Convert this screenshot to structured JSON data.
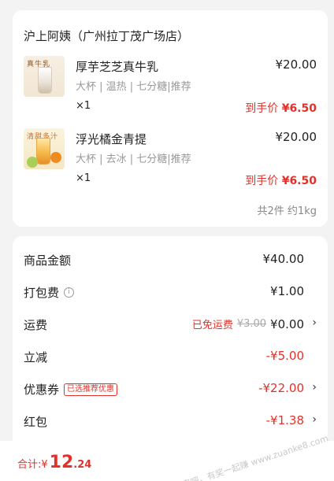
{
  "store": {
    "name": "沪上阿姨（广州拉丁茂广场店）"
  },
  "products": [
    {
      "thumb_label": "真牛乳",
      "name": "厚芋芝芝真牛乳",
      "spec": "大杯 | 温热 | 七分糖|推荐",
      "qty": "×1",
      "price": "¥20.00",
      "final_prefix": "到手价",
      "final_amount": "¥6.50"
    },
    {
      "thumb_label": "清甜多汁",
      "name": "浮光橘金青提",
      "spec": "大杯 | 去冰 | 七分糖|推荐",
      "qty": "×1",
      "price": "¥20.00",
      "final_prefix": "到手价",
      "final_amount": "¥6.50"
    }
  ],
  "summary": "共2件 约1kg",
  "fees": {
    "goods": {
      "label": "商品金额",
      "value": "¥40.00"
    },
    "pack": {
      "label": "打包费",
      "value": "¥1.00",
      "icon": "info-icon"
    },
    "ship": {
      "label": "运费",
      "note": "已免运费",
      "original": "¥3.00",
      "value": "¥0.00"
    },
    "reduce": {
      "label": "立减",
      "value": "-¥5.00"
    },
    "coupon": {
      "label": "优惠券",
      "badge": "已选推荐优惠",
      "value": "-¥22.00"
    },
    "redpack": {
      "label": "红包",
      "value": "-¥1.38"
    }
  },
  "footer": {
    "total_label": "合计:",
    "currency": "¥",
    "integer": "12",
    "decimal": ".24"
  },
  "watermark": "赚客吧，有奖一起赚 www.zuanke8.com",
  "colors": {
    "accent_red": "#e0322a",
    "background": "#f3f3f3",
    "card": "#ffffff",
    "muted": "#999999"
  }
}
